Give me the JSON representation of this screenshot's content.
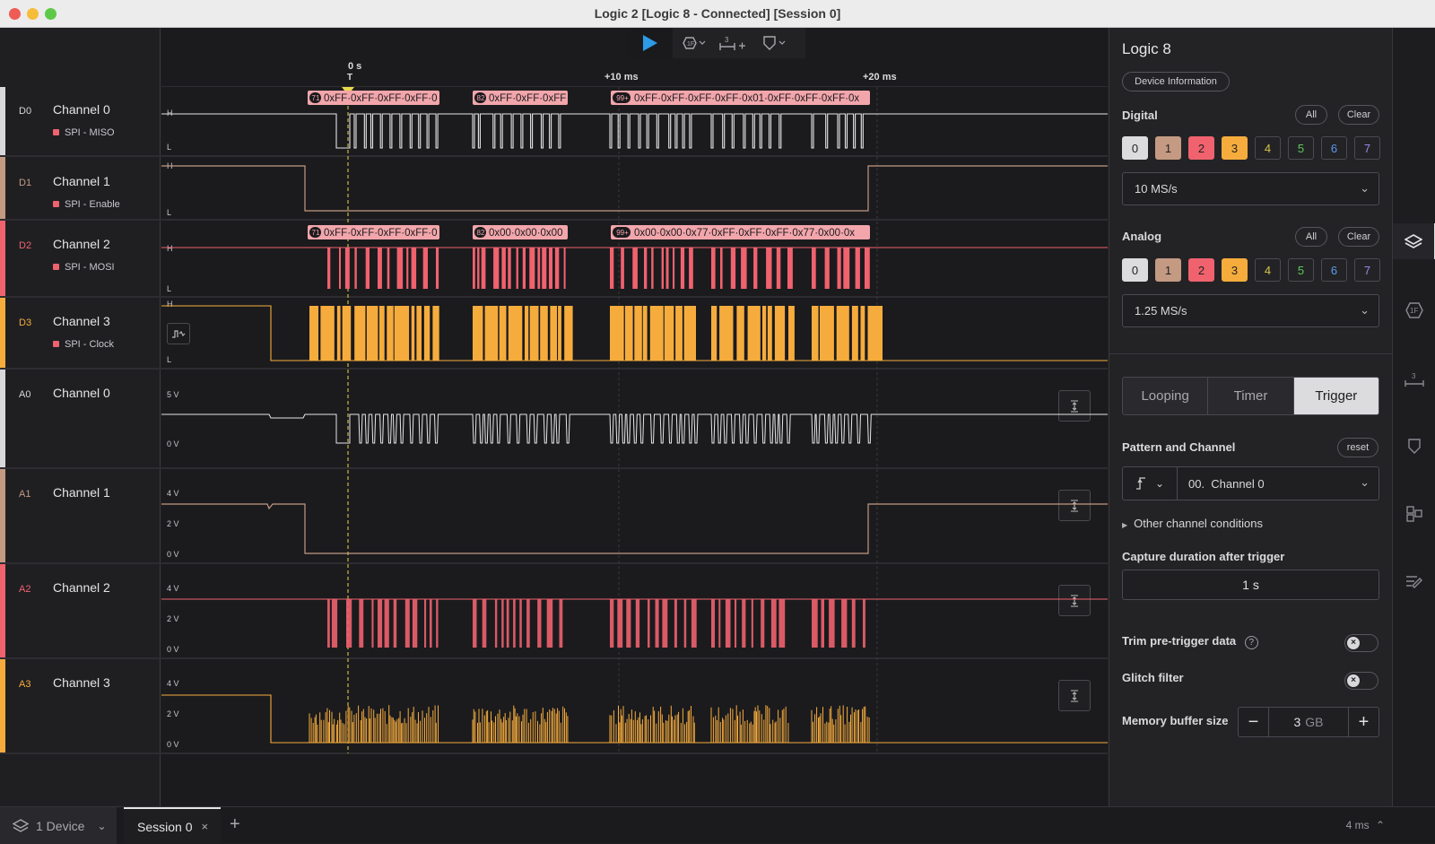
{
  "window": {
    "title": "Logic 2 [Logic 8 - Connected] [Session 0]"
  },
  "ruler": {
    "zero": "0 s",
    "trigger": "T",
    "m10": "+10 ms",
    "m20": "+20 ms"
  },
  "channels": {
    "d0": {
      "id": "D0",
      "name": "Channel 0",
      "tag": "SPI - MISO",
      "h": "H",
      "l": "L"
    },
    "d1": {
      "id": "D1",
      "name": "Channel 1",
      "tag": "SPI - Enable",
      "h": "H",
      "l": "L"
    },
    "d2": {
      "id": "D2",
      "name": "Channel 2",
      "tag": "SPI - MOSI",
      "h": "H",
      "l": "L"
    },
    "d3": {
      "id": "D3",
      "name": "Channel 3",
      "tag": "SPI - Clock",
      "h": "H",
      "l": "L"
    },
    "a0": {
      "id": "A0",
      "name": "Channel 0",
      "v1": "5 V",
      "v2": "0 V"
    },
    "a1": {
      "id": "A1",
      "name": "Channel 1",
      "v1": "4 V",
      "v2": "2 V",
      "v3": "0 V"
    },
    "a2": {
      "id": "A2",
      "name": "Channel 2",
      "v1": "4 V",
      "v2": "2 V",
      "v3": "0 V"
    },
    "a3": {
      "id": "A3",
      "name": "Channel 3",
      "v1": "4 V",
      "v2": "2 V",
      "v3": "0 V"
    }
  },
  "decode": {
    "miso": [
      {
        "count": "71",
        "text": "0xFF·0xFF·0xFF·0xFF·0"
      },
      {
        "count": "82",
        "text": "0xFF·0xFF·0xFF"
      },
      {
        "count": "99+",
        "text": "0xFF·0xFF·0xFF·0xFF·0x01·0xFF·0xFF·0xFF·0x"
      }
    ],
    "mosi": [
      {
        "count": "71",
        "text": "0xFF·0xFF·0xFF·0xFF·0"
      },
      {
        "count": "82",
        "text": "0x00·0x00·0x00"
      },
      {
        "count": "99+",
        "text": "0x00·0x00·0x77·0xFF·0xFF·0xFF·0x77·0x00·0x"
      }
    ]
  },
  "panel": {
    "title": "Logic 8",
    "device_info": "Device Information",
    "digital": "Digital",
    "analog": "Analog",
    "all": "All",
    "clear": "Clear",
    "chip_labels": [
      "0",
      "1",
      "2",
      "3",
      "4",
      "5",
      "6",
      "7"
    ],
    "digital_rate": "10 MS/s",
    "analog_rate": "1.25 MS/s",
    "modes": {
      "looping": "Looping",
      "timer": "Timer",
      "trigger": "Trigger"
    },
    "pattern_channel": "Pattern and Channel",
    "reset": "reset",
    "channel_select": "00.  Channel 0",
    "other_conditions": "Other channel conditions",
    "capture_duration_label": "Capture duration after trigger",
    "capture_duration": "1 s",
    "trim": "Trim pre-trigger data",
    "glitch": "Glitch filter",
    "memory": "Memory buffer size",
    "memory_value": "3",
    "memory_unit": "GB"
  },
  "bottom": {
    "devices": "1 Device",
    "session_tab": "Session 0",
    "add": "+",
    "time": "4 ms"
  },
  "colors": {
    "white": "#e6e6e6",
    "brown": "#c49a82",
    "red": "#f0626e",
    "orange": "#f6ac3c",
    "yellow": "#d8c24a",
    "green": "#5cc85c",
    "blue": "#5a9ae8",
    "violet": "#9a8ae8"
  },
  "icons": [
    "play-icon",
    "protocol-icon",
    "measure-icon",
    "marker-icon",
    "layers-icon",
    "list-icon"
  ]
}
